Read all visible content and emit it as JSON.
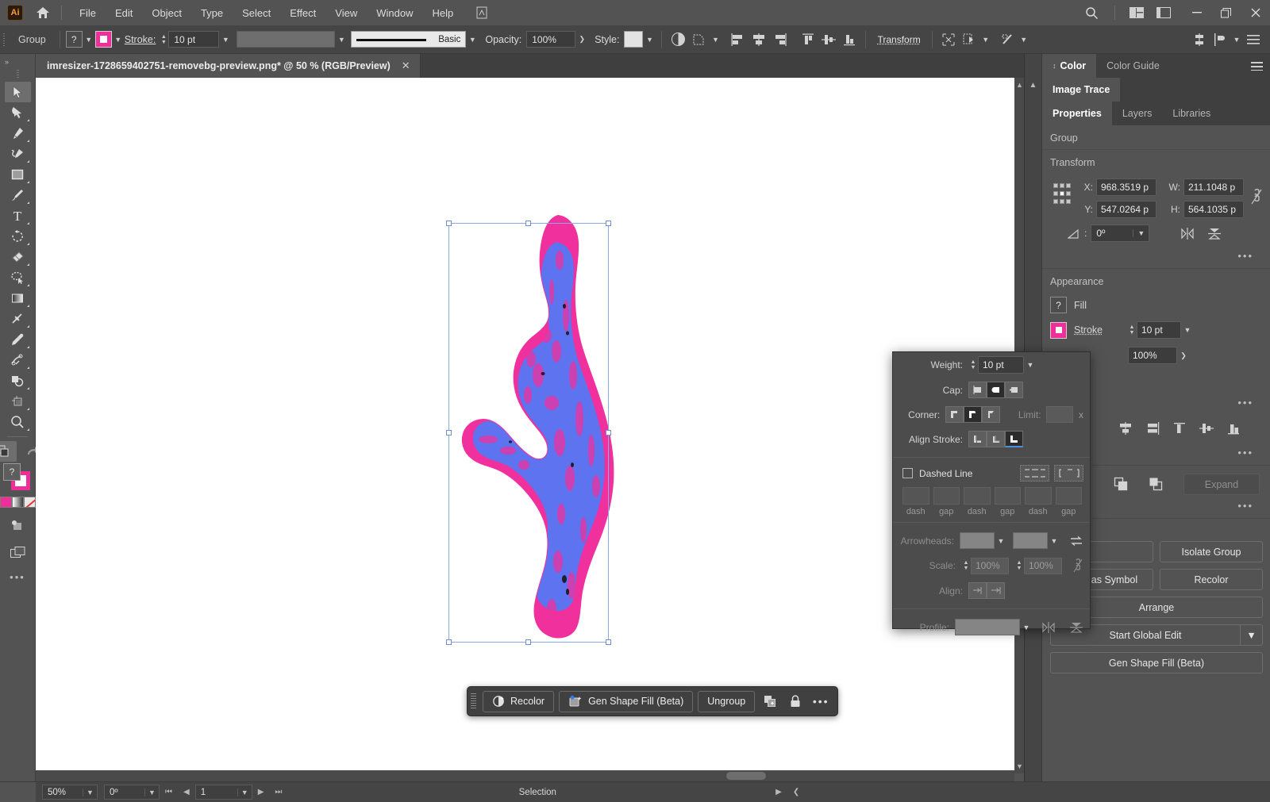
{
  "app": {
    "logo": "Ai",
    "menus": [
      "File",
      "Edit",
      "Object",
      "Type",
      "Select",
      "Effect",
      "View",
      "Window",
      "Help"
    ],
    "window_controls": {
      "minimize": "—",
      "maximize": "❐",
      "close": "✕"
    }
  },
  "control_bar": {
    "selection_label": "Group",
    "fill_swatch": "?",
    "stroke_label": "Stroke:",
    "stroke_weight": "10 pt",
    "brush_label": "Basic",
    "opacity_label": "Opacity:",
    "opacity_value": "100%",
    "style_label": "Style:",
    "transform_label": "Transform"
  },
  "document": {
    "tab_title": "imresizer-1728659402751-removebg-preview.png* @ 50 % (RGB/Preview)",
    "close": "✕"
  },
  "tools": [
    {
      "name": "selection-tool",
      "label": "Selection"
    },
    {
      "name": "direct-selection-tool",
      "label": "Direct Selection"
    },
    {
      "name": "pen-tool",
      "label": "Pen"
    },
    {
      "name": "curvature-tool",
      "label": "Curvature"
    },
    {
      "name": "rectangle-tool",
      "label": "Rectangle"
    },
    {
      "name": "paintbrush-tool",
      "label": "Paintbrush"
    },
    {
      "name": "type-tool",
      "label": "Type"
    },
    {
      "name": "rotate-tool",
      "label": "Rotate"
    },
    {
      "name": "eraser-tool",
      "label": "Eraser"
    },
    {
      "name": "lasso-tool",
      "label": "Lasso"
    },
    {
      "name": "gradient-tool",
      "label": "Gradient"
    },
    {
      "name": "width-tool",
      "label": "Width"
    },
    {
      "name": "eyedropper-tool",
      "label": "Eyedropper"
    },
    {
      "name": "puppet-warp-tool",
      "label": "Puppet Warp"
    },
    {
      "name": "shape-builder-tool",
      "label": "Shape Builder"
    },
    {
      "name": "artboard-tool",
      "label": "Artboard"
    },
    {
      "name": "zoom-tool",
      "label": "Zoom"
    }
  ],
  "panels": {
    "color_tabs": [
      "Color",
      "Color Guide"
    ],
    "image_trace_tab": "Image Trace",
    "property_tabs": [
      "Properties",
      "Layers",
      "Libraries"
    ],
    "selection_type": "Group",
    "transform": {
      "title": "Transform",
      "x_label": "X:",
      "x_value": "968.3519 p",
      "y_label": "Y:",
      "y_value": "547.0264 p",
      "w_label": "W:",
      "w_value": "211.1048 p",
      "h_label": "H:",
      "h_value": "564.1035 p",
      "angle_value": "0º",
      "more": "•••"
    },
    "appearance": {
      "title": "Appearance",
      "fill_label": "Fill",
      "fill_swatch": "?",
      "stroke_label": "Stroke",
      "stroke_weight": "10 pt",
      "opacity_value": "100%",
      "more": "•••"
    },
    "quick_actions": {
      "expand_label": "Expand",
      "isolate_group_label": "Isolate Group",
      "save_as_symbol_label": "Save as Symbol",
      "recolor_label": "Recolor",
      "arrange_label": "Arrange",
      "start_global_edit_label": "Start Global Edit",
      "gen_shape_fill_label": "Gen Shape Fill (Beta)",
      "more": "•••"
    }
  },
  "stroke_panel": {
    "weight_label": "Weight:",
    "weight_value": "10 pt",
    "cap_label": "Cap:",
    "corner_label": "Corner:",
    "limit_label": "Limit:",
    "limit_unit": "x",
    "align_stroke_label": "Align Stroke:",
    "dashed_line_label": "Dashed Line",
    "dash_captions": [
      "dash",
      "gap",
      "dash",
      "gap",
      "dash",
      "gap"
    ],
    "arrowheads_label": "Arrowheads:",
    "scale_label": "Scale:",
    "scale_value_1": "100%",
    "scale_value_2": "100%",
    "align_label": "Align:",
    "profile_label": "Profile:"
  },
  "context_toolbar": {
    "recolor_label": "Recolor",
    "gen_shape_fill_label": "Gen Shape Fill (Beta)",
    "ungroup_label": "Ungroup"
  },
  "status_bar": {
    "zoom_value": "50%",
    "rotation_value": "0º",
    "artboard_value": "1",
    "status_text": "Selection"
  },
  "colors": {
    "stroke_magenta": "#ef2e9a",
    "fill_blue": "#5d73f0",
    "accent_blue": "#4a90e2",
    "panel_bg": "#535353",
    "dock_bg": "#3f3f3f",
    "canvas_bg": "#ffffff"
  }
}
